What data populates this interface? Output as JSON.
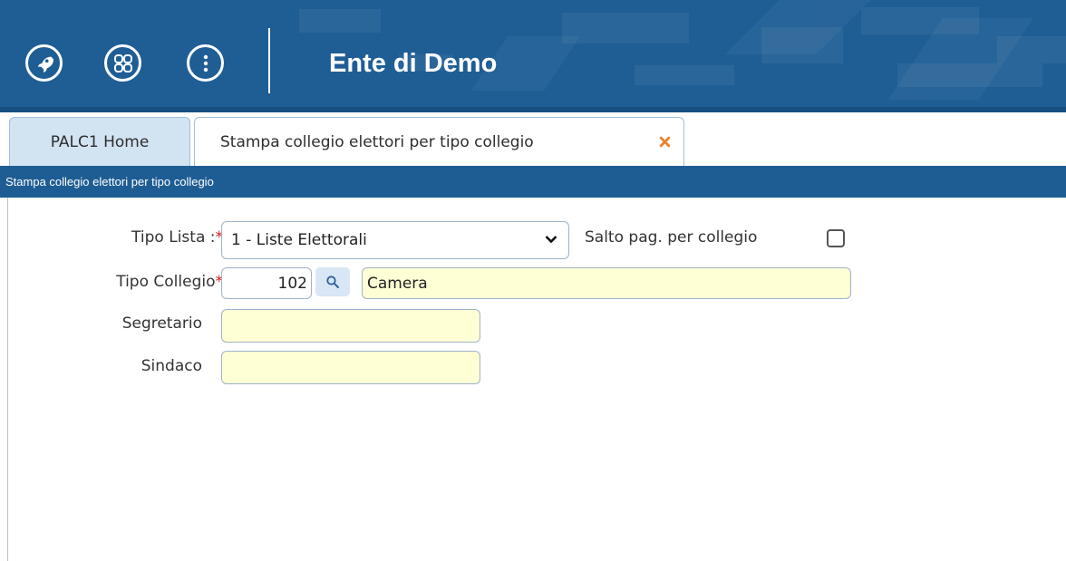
{
  "header": {
    "title": "Ente di Demo",
    "background_color": "#1f5e95",
    "buttons": [
      {
        "icon": "rocket-icon"
      },
      {
        "icon": "apps-grid-icon"
      },
      {
        "icon": "more-vertical-icon"
      }
    ]
  },
  "tabs": [
    {
      "label": "PALC1 Home",
      "active": false
    },
    {
      "label": "Stampa collegio elettori per tipo collegio",
      "active": true,
      "close_icon": "close-icon",
      "close_color": "#e8832a"
    }
  ],
  "subtitle_bar": {
    "text": "Stampa collegio elettori per tipo collegio"
  },
  "form": {
    "tipo_lista": {
      "label": "Tipo Lista :",
      "required_mark": "*",
      "value": "1 - Liste Elettorali"
    },
    "salto_pagina": {
      "label": "Salto pag. per collegio",
      "checked": false
    },
    "tipo_collegio": {
      "label": "Tipo Collegio",
      "required_mark": "*",
      "code": "102",
      "description": "Camera",
      "lookup_icon": "search-icon"
    },
    "segretario": {
      "label": "Segretario",
      "value": ""
    },
    "sindaco": {
      "label": "Sindaco",
      "value": ""
    }
  },
  "colors": {
    "accent": "#1f5e95",
    "required": "#d11b1b",
    "readonly_field": "#ffffd6",
    "tab_inactive": "#d2e3f2"
  }
}
